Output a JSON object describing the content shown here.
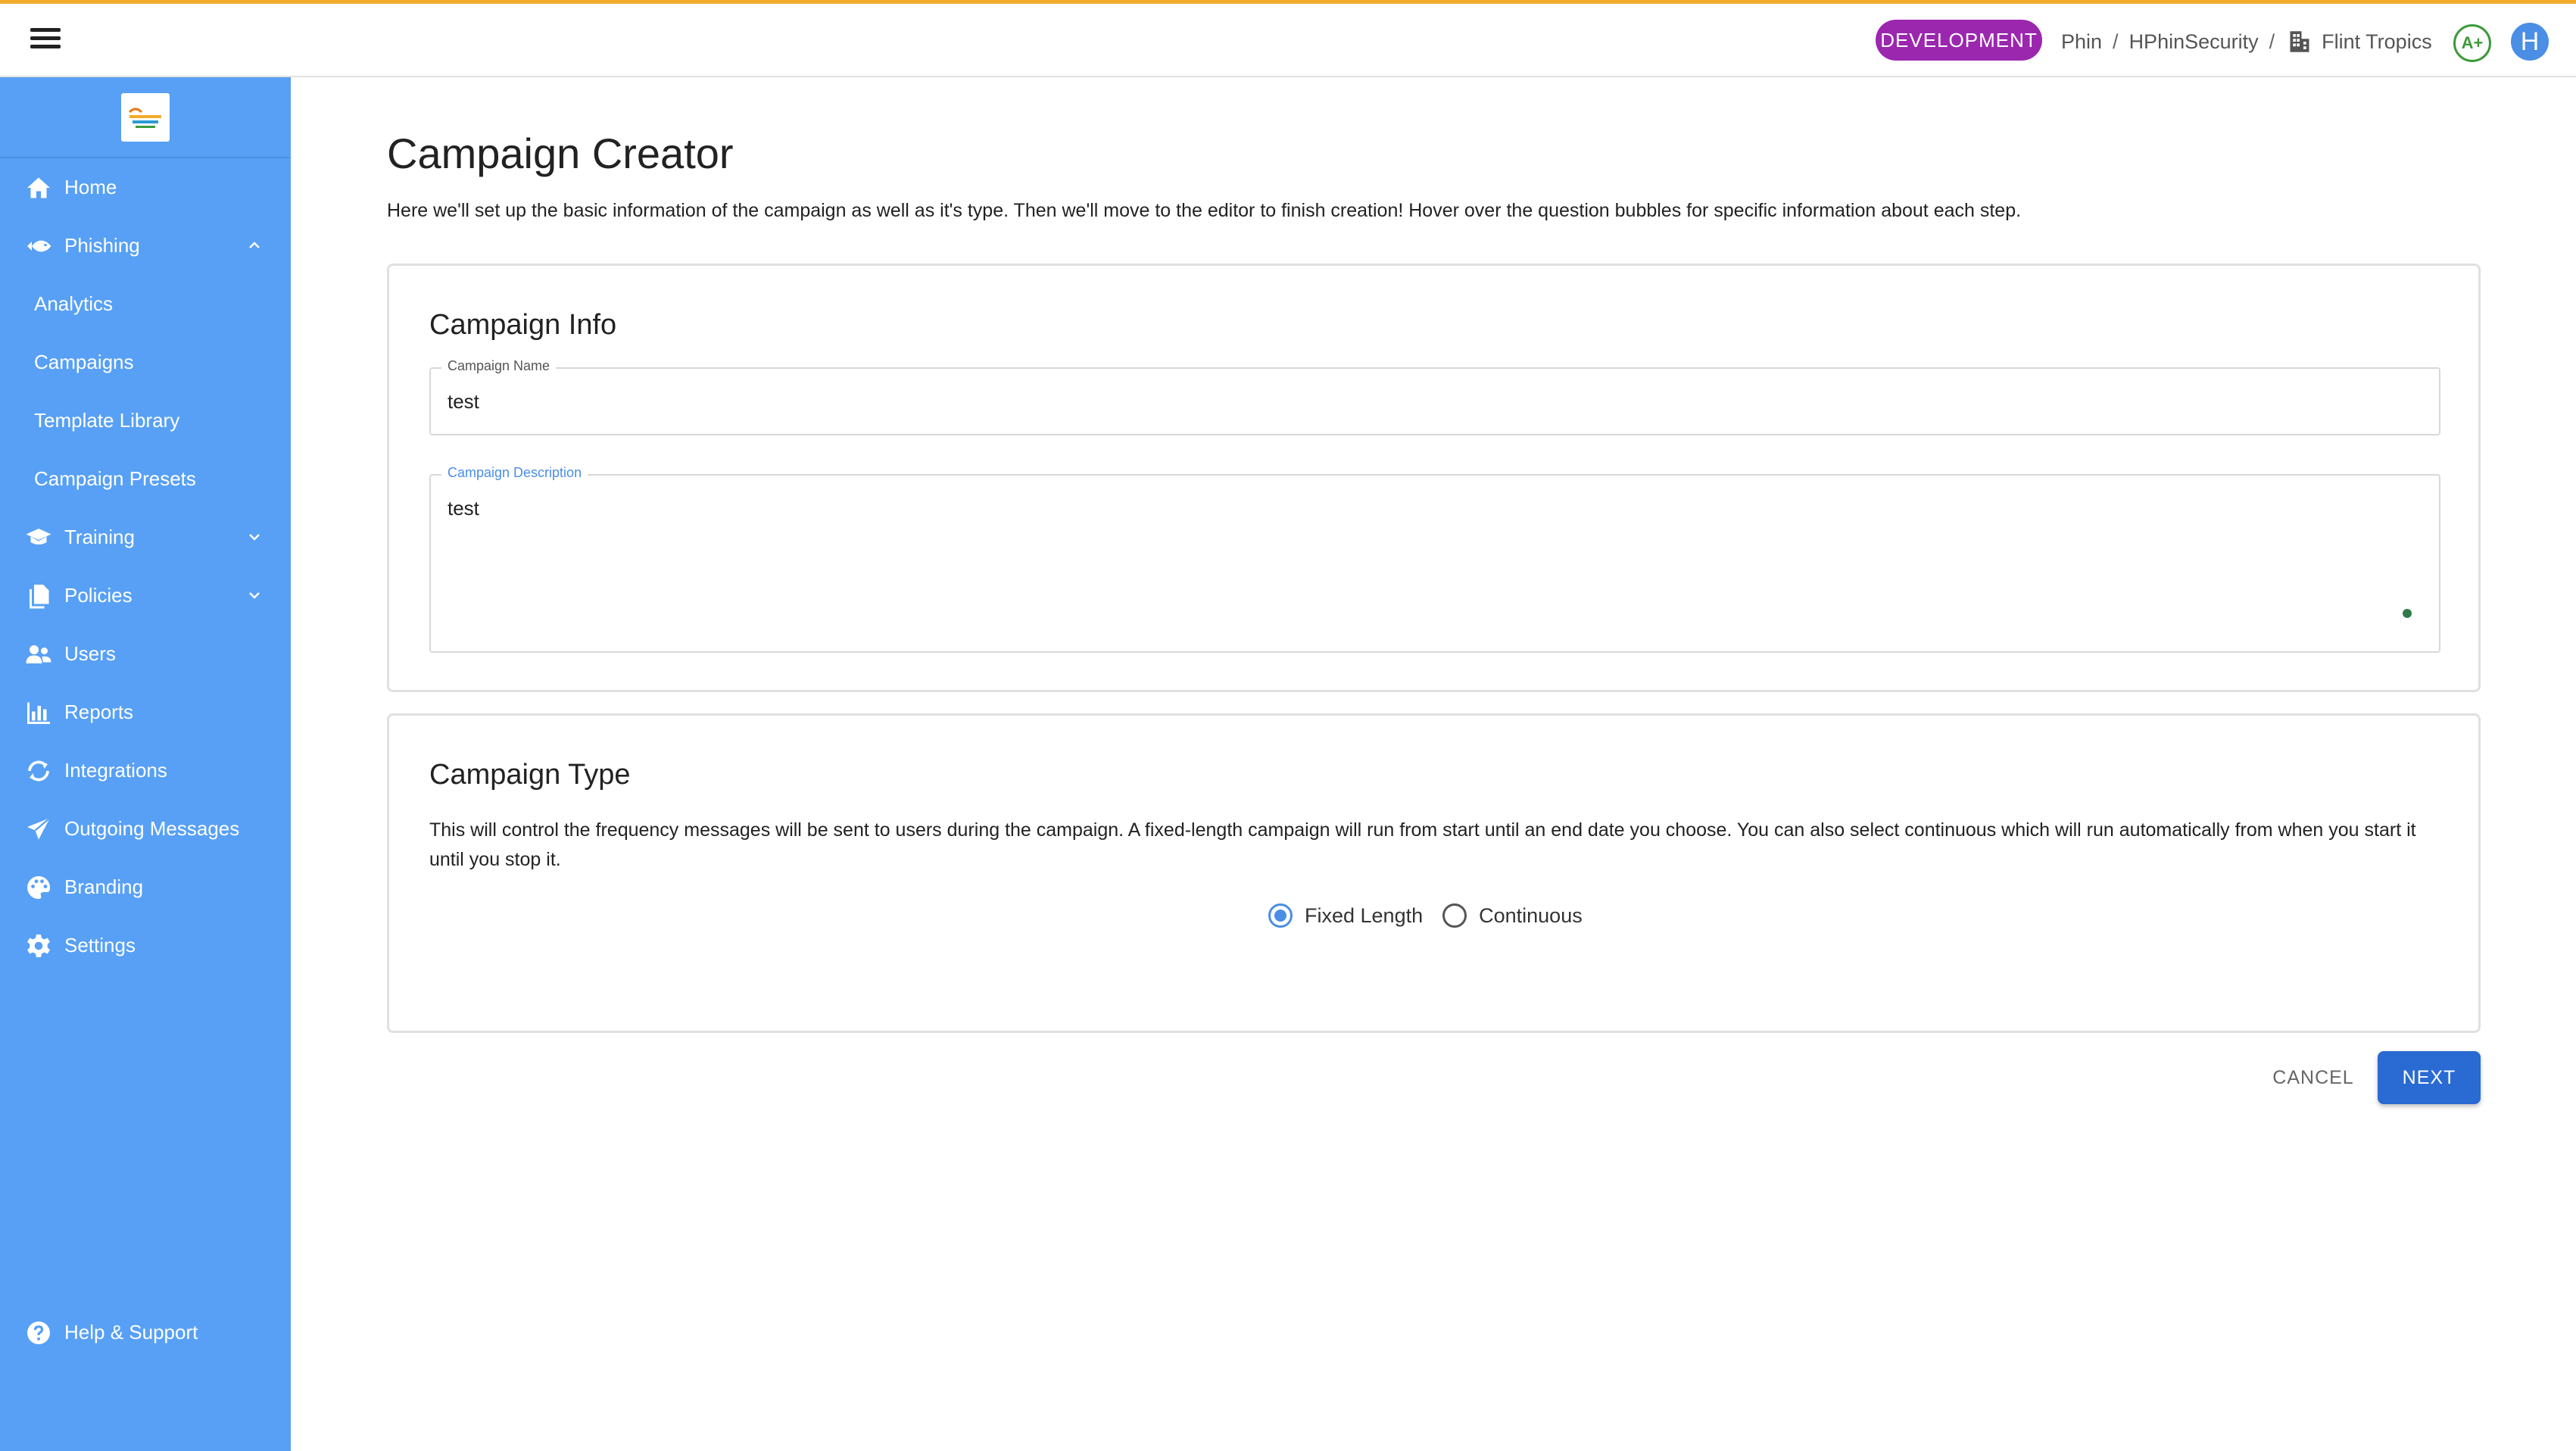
{
  "topbar": {
    "environment": "DEVELOPMENT",
    "breadcrumbs": [
      "Phin",
      "HPhinSecurity",
      "Flint Tropics"
    ],
    "separator": "/",
    "score": "A+",
    "avatar_initial": "H"
  },
  "sidebar": {
    "items": [
      {
        "label": "Home",
        "icon": "home-icon"
      },
      {
        "label": "Phishing",
        "icon": "fish-icon",
        "expanded": true
      },
      {
        "label": "Analytics"
      },
      {
        "label": "Campaigns"
      },
      {
        "label": "Template Library"
      },
      {
        "label": "Campaign Presets"
      },
      {
        "label": "Training",
        "icon": "graduation-cap-icon",
        "expanded": false
      },
      {
        "label": "Policies",
        "icon": "documents-icon",
        "expanded": false
      },
      {
        "label": "Users",
        "icon": "users-icon"
      },
      {
        "label": "Reports",
        "icon": "bar-chart-icon"
      },
      {
        "label": "Integrations",
        "icon": "sync-icon"
      },
      {
        "label": "Outgoing Messages",
        "icon": "paper-plane-icon"
      },
      {
        "label": "Branding",
        "icon": "palette-icon"
      },
      {
        "label": "Settings",
        "icon": "gear-icon"
      }
    ],
    "help": {
      "label": "Help & Support",
      "icon": "question-circle-icon"
    }
  },
  "main": {
    "title": "Campaign Creator",
    "description": "Here we'll set up the basic information of the campaign as well as it's type. Then we'll move to the editor to finish creation! Hover over the question bubbles for specific information about each step.",
    "info_card": {
      "title": "Campaign Info",
      "name_label": "Campaign Name",
      "name_value": "test",
      "desc_label": "Campaign Description",
      "desc_value": "test"
    },
    "type_card": {
      "title": "Campaign Type",
      "description": "This will control the frequency messages will be sent to users during the campaign. A fixed-length campaign will run from start until an end date you choose. You can also select continuous which will run automatically from when you start it until you stop it.",
      "options": [
        {
          "label": "Fixed Length",
          "selected": true
        },
        {
          "label": "Continuous",
          "selected": false
        }
      ]
    },
    "actions": {
      "cancel": "CANCEL",
      "next": "NEXT"
    }
  },
  "colors": {
    "sidebar": "#57a0f5",
    "accent": "#2a6ad3",
    "environment_badge": "#9b27af",
    "top_border": "#f2ab2b",
    "score": "#3d9a3a"
  }
}
